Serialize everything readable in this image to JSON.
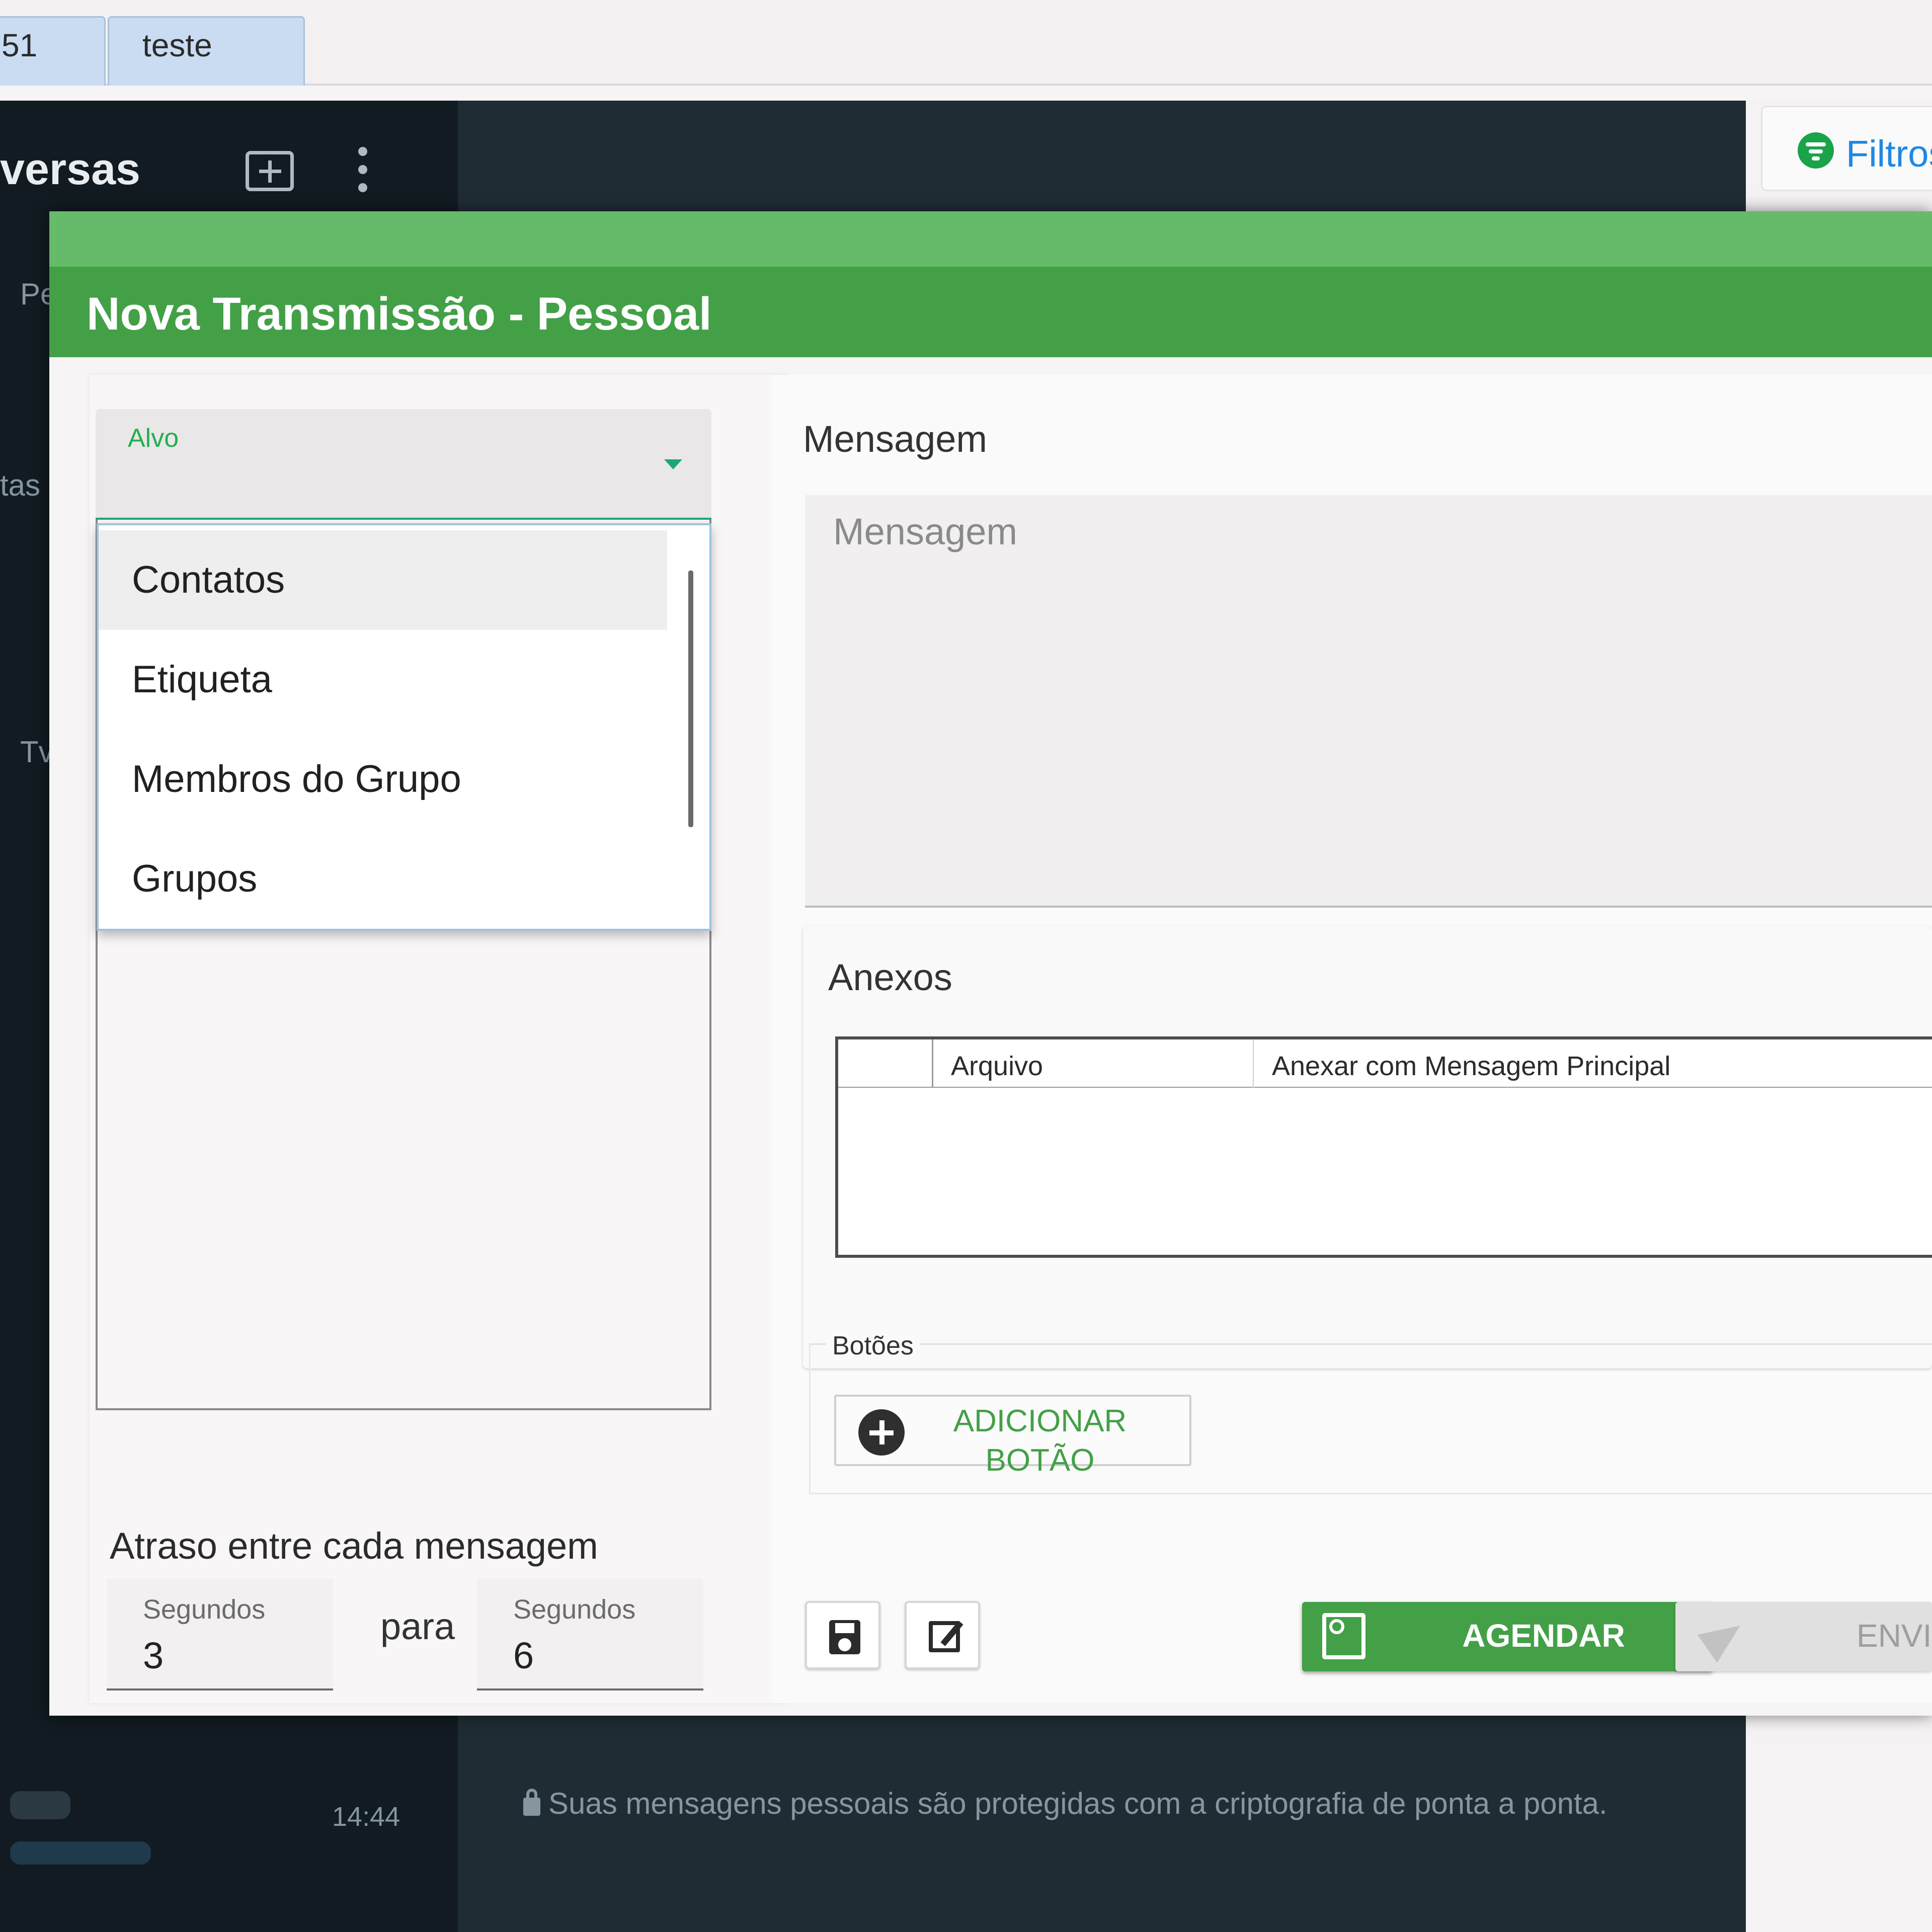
{
  "browser_tabs": [
    {
      "label": "51"
    },
    {
      "label": "teste"
    }
  ],
  "sidebar": {
    "title": "versas",
    "partial_labels": [
      "Pe",
      "tas",
      "Tv"
    ],
    "last_time": "14:44"
  },
  "filter": {
    "label": "Filtros"
  },
  "encryption_note": "Suas mensagens pessoais são protegidas com a criptografia de ponta a ponta.",
  "dialog": {
    "title": "Nova Transmissão - Pessoal",
    "target": {
      "label": "Alvo",
      "options": [
        "Contatos",
        "Etiqueta",
        "Membros do Grupo",
        "Grupos"
      ],
      "highlighted": "Contatos"
    },
    "delay": {
      "label": "Atraso entre cada mensagem",
      "from_label": "Segundos",
      "from_value": "3",
      "separator": "para",
      "to_label": "Segundos",
      "to_value": "6"
    },
    "message": {
      "section_label": "Mensagem",
      "placeholder": "Mensagem"
    },
    "attachments": {
      "section_label": "Anexos",
      "columns": [
        "",
        "Arquivo",
        "Anexar com Mensagem Principal"
      ]
    },
    "buttons_section": {
      "legend": "Botões",
      "add_label": "ADICIONAR BOTÃO"
    },
    "actions": {
      "schedule_label": "AGENDAR",
      "send_label": "ENVI"
    }
  },
  "colors": {
    "header_green": "#43a047",
    "header_green_light": "#66bb6a",
    "accent_teal": "#1ea67b",
    "filter_blue": "#1e88e5"
  }
}
